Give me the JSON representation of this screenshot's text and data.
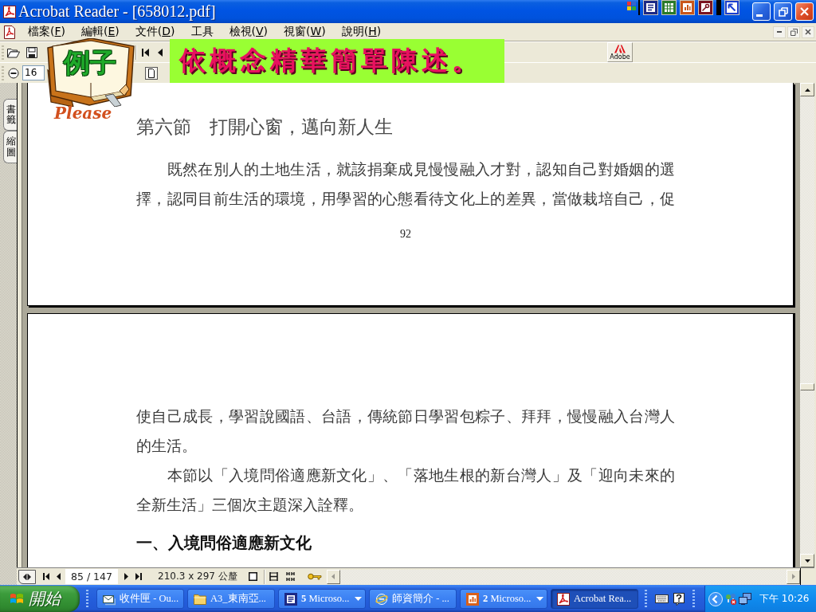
{
  "window": {
    "title": "Acrobat Reader - [658012.pdf]"
  },
  "menu": [
    {
      "text": "檔案(",
      "mnemonic": "F",
      "after": ")"
    },
    {
      "text": "編輯(",
      "mnemonic": "E",
      "after": ")"
    },
    {
      "text": "文件(",
      "mnemonic": "D",
      "after": ")"
    },
    {
      "text": "工具"
    },
    {
      "text": "檢視(",
      "mnemonic": "V",
      "after": ")"
    },
    {
      "text": "視窗(",
      "mnemonic": "W",
      "after": ")"
    },
    {
      "text": "說明(",
      "mnemonic": "H",
      "after": ")"
    }
  ],
  "toolbar": {
    "zoom_value": "16",
    "logo_text": "Adobe"
  },
  "overlay": {
    "book_label": "例子",
    "caption": "Please",
    "banner": "依概念精華簡單陳述。"
  },
  "side_tabs": [
    {
      "label": "書籤",
      "selected": false
    },
    {
      "label": "縮圖",
      "selected": false
    }
  ],
  "pages": [
    {
      "blocks": [
        {
          "kind": "section_title",
          "text": "第六節　打開心窗，邁向新人生"
        },
        {
          "kind": "paragraph",
          "text": "既然在別人的土地生活，就該捐棄成見慢慢融入才對，認知自己對婚姻的選擇，認同目前生活的環境，用學習的心態看待文化上的差異，當做栽培自己，促",
          "indent": true,
          "continues": true
        },
        {
          "kind": "page_number",
          "text": "92"
        }
      ]
    },
    {
      "blocks": [
        {
          "kind": "paragraph",
          "text": "使自己成長，學習說國語、台語，傳統節日學習包粽子、拜拜，慢慢融入台灣人的生活。",
          "indent": false,
          "continues": false
        },
        {
          "kind": "paragraph",
          "text": "本節以「入境問俗適應新文化」、「落地生根的新台灣人」及「迎向未來的全新生活」三個次主題深入詮釋。",
          "indent": true,
          "continues": false
        },
        {
          "kind": "subheading",
          "text": "一、入境問俗適應新文化"
        }
      ]
    }
  ],
  "status_bar": {
    "page": "85 / 147",
    "page_size": "210.3 x 297 公釐"
  },
  "taskbar": {
    "start": "開始",
    "tasks": [
      {
        "label": "收件匣 - Ou...",
        "grouped": false,
        "selected": false
      },
      {
        "label": "A3_東南亞...",
        "grouped": false,
        "selected": false
      },
      {
        "label": "**5** Microso...",
        "grouped": true,
        "selected": false
      },
      {
        "label": "師資簡介 - ...",
        "grouped": false,
        "selected": false
      },
      {
        "label": "**2** Microso...",
        "grouped": true,
        "selected": false
      },
      {
        "label": "Acrobat Rea...",
        "grouped": false,
        "selected": true
      }
    ],
    "clock": "下午 10:26"
  }
}
